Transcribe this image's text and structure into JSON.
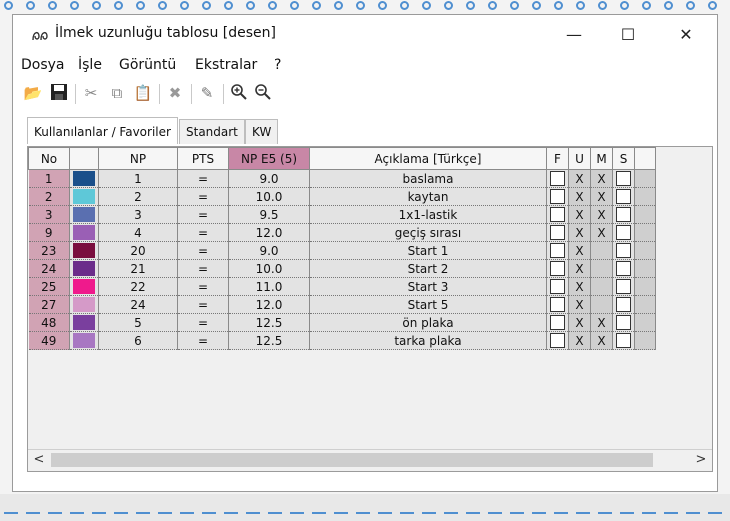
{
  "window": {
    "title": "İlmek uzunluğu tablosu [desen]",
    "minimize": "—",
    "maximize": "☐",
    "close": "✕"
  },
  "menu": [
    "Dosya",
    "İşle",
    "Görüntü",
    "Ekstralar",
    "?"
  ],
  "tabs": [
    "Kullanılanlar / Favoriler",
    "Standart",
    "KW"
  ],
  "table": {
    "headers": [
      "No",
      "",
      "NP",
      "PTS",
      "NP E5 (5)",
      "Açıklama [Türkçe]",
      "F",
      "U",
      "M",
      "S"
    ],
    "rows": [
      {
        "no": "1",
        "color": "#1a4f8a",
        "np": "1",
        "pts": "=",
        "npe5": "9.0",
        "desc": "baslama",
        "u": "X",
        "m": "X"
      },
      {
        "no": "2",
        "color": "#5ec8d8",
        "np": "2",
        "pts": "=",
        "npe5": "10.0",
        "desc": "kaytan",
        "u": "X",
        "m": "X"
      },
      {
        "no": "3",
        "color": "#5a6fb0",
        "np": "3",
        "pts": "=",
        "npe5": "9.5",
        "desc": "1x1-lastik",
        "u": "X",
        "m": "X"
      },
      {
        "no": "9",
        "color": "#9a5fb5",
        "np": "4",
        "pts": "=",
        "npe5": "12.0",
        "desc": "geçiş sırası",
        "u": "X",
        "m": "X"
      },
      {
        "no": "23",
        "color": "#7a0e3e",
        "np": "20",
        "pts": "=",
        "npe5": "9.0",
        "desc": "Start 1",
        "u": "X",
        "m": ""
      },
      {
        "no": "24",
        "color": "#6b2c8a",
        "np": "21",
        "pts": "=",
        "npe5": "10.0",
        "desc": "Start 2",
        "u": "X",
        "m": ""
      },
      {
        "no": "25",
        "color": "#ef1a8c",
        "np": "22",
        "pts": "=",
        "npe5": "11.0",
        "desc": "Start 3",
        "u": "X",
        "m": ""
      },
      {
        "no": "27",
        "color": "#d59ac8",
        "np": "24",
        "pts": "=",
        "npe5": "12.0",
        "desc": "Start 5",
        "u": "X",
        "m": ""
      },
      {
        "no": "48",
        "color": "#7a3f9e",
        "np": "5",
        "pts": "=",
        "npe5": "12.5",
        "desc": "ön plaka",
        "u": "X",
        "m": "X"
      },
      {
        "no": "49",
        "color": "#a877c2",
        "np": "6",
        "pts": "=",
        "npe5": "12.5",
        "desc": "tarka plaka",
        "u": "X",
        "m": "X"
      }
    ]
  },
  "scroll": {
    "left": "<",
    "right": ">"
  },
  "colors": {
    "accent_header": "#c887a6",
    "no_cell": "#d1a3b4"
  }
}
